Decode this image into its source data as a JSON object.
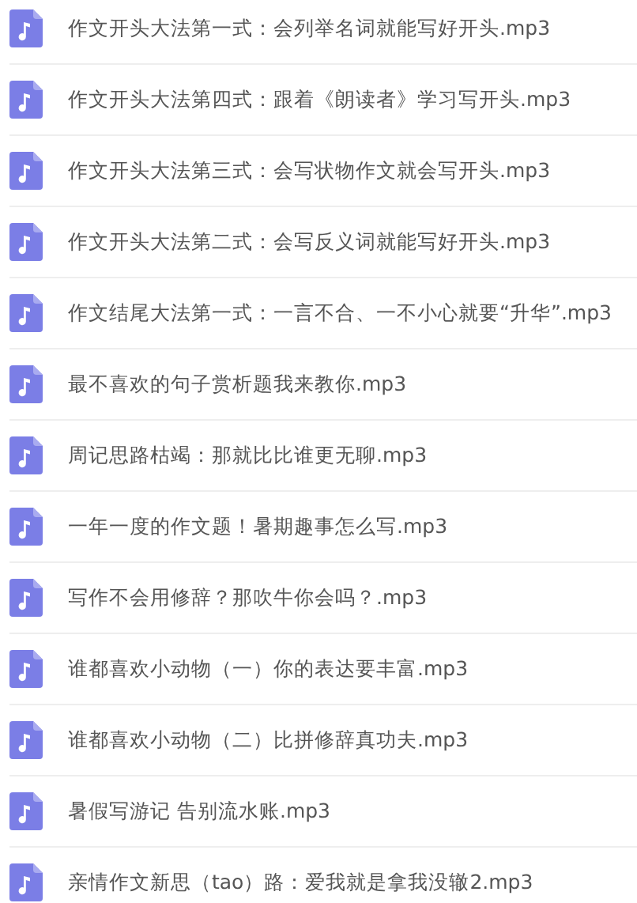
{
  "files": [
    {
      "name": "作文开头大法第一式：会列举名词就能写好开头.mp3"
    },
    {
      "name": "作文开头大法第四式：跟着《朗读者》学习写开头.mp3"
    },
    {
      "name": "作文开头大法第三式：会写状物作文就会写开头.mp3"
    },
    {
      "name": "作文开头大法第二式：会写反义词就能写好开头.mp3"
    },
    {
      "name": "作文结尾大法第一式：一言不合、一不小心就要“升华”.mp3"
    },
    {
      "name": "最不喜欢的句子赏析题我来教你.mp3"
    },
    {
      "name": "周记思路枯竭：那就比比谁更无聊.mp3"
    },
    {
      "name": "一年一度的作文题！暑期趣事怎么写.mp3"
    },
    {
      "name": "写作不会用修辞？那吹牛你会吗？.mp3"
    },
    {
      "name": "谁都喜欢小动物（一）你的表达要丰富.mp3"
    },
    {
      "name": "谁都喜欢小动物（二）比拼修辞真功夫.mp3"
    },
    {
      "name": "暑假写游记 告别流水账.mp3"
    },
    {
      "name": "亲情作文新思（tao）路：爱我就是拿我没辙2.mp3"
    }
  ]
}
